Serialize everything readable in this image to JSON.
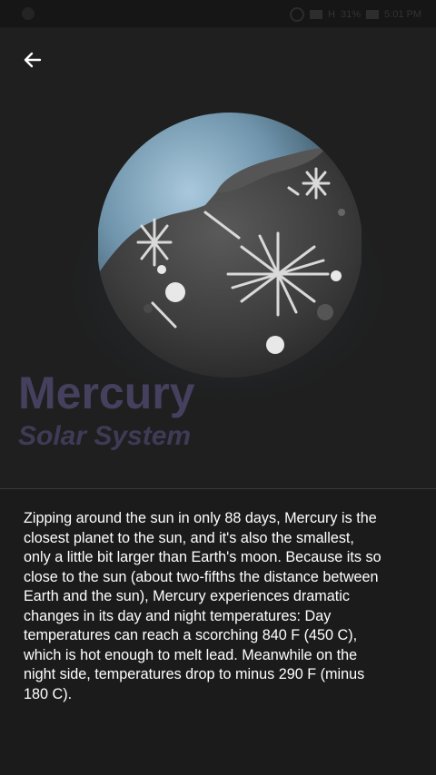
{
  "status_bar": {
    "network": "H",
    "battery": "31%",
    "time": "5:01 PM"
  },
  "header": {
    "back_icon": "arrow-left-icon",
    "title": "Mercury",
    "subtitle": "Solar System"
  },
  "colors": {
    "background": "#1b1b1b",
    "header_background": "#1f1f1f",
    "title": "#44405e",
    "subtitle": "#3f3b56",
    "body_text": "#ffffff"
  },
  "planet": {
    "illustration": "mercury-planet-illustration"
  },
  "description": "Zipping around the sun in only 88 days, Mercury is the\nclosest planet to the sun, and it's also the smallest,\nonly a little bit larger than Earth's moon. Because its so\nclose to the sun (about two-fifths the distance between\nEarth and the sun), Mercury experiences dramatic\nchanges in its day and night temperatures: Day\ntemperatures can reach a scorching 840  F (450 C),\nwhich is hot enough to melt lead. Meanwhile on the\nnight side, temperatures drop to minus 290 F (minus\n180 C)."
}
